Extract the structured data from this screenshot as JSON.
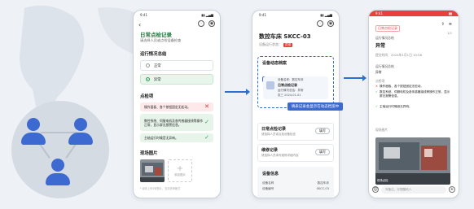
{
  "colors": {
    "accent_green": "#1f7a3e",
    "accent_blue": "#3d6ad0",
    "accent_red": "#e8413c"
  },
  "phone1": {
    "time": "9:41",
    "title": "日常点检记录",
    "subtitle": "请选择人员或点检设备检查",
    "run_section": "运行情况总结",
    "options": [
      "正常",
      "异常"
    ],
    "checks_section": "点检项",
    "checks": [
      {
        "text": "操作面板、各个按钮固定无松动。",
        "status": "bad"
      },
      {
        "text": "数控系统、伺服电机及各传感器接线等操作正常，显示屏无报警信息。",
        "status": "good"
      },
      {
        "text": "主轴运行时噪音无异响。",
        "status": "good"
      }
    ],
    "photos_section": "现场图片",
    "add_photo": "添加图片",
    "hint": "* 最多上传9张照片，支持多种格式"
  },
  "phone2": {
    "time": "9:41",
    "title": "数控车床 SKCC-03",
    "subtitle": "设备运行状态：",
    "status_tag": "异常",
    "dynamics_title": "设备动态档案",
    "chips": [
      "维修记录 1",
      "日常点检 1"
    ],
    "mini": {
      "line1": "设备名称：数控车床",
      "line2": "日常点检记录",
      "line3": "运行情况总结：异常",
      "line4": "张三 2024-01-01"
    },
    "callout": "填表记录会显示在动态档案中",
    "records": [
      {
        "title": "日常点检记录",
        "desc": "请选择人员或点检设备检查",
        "btn": "填写"
      },
      {
        "title": "维修记录",
        "desc": "请选择人员填写维修详细内容",
        "btn": "填写"
      }
    ],
    "device_info": "设备信息",
    "device_rows": [
      {
        "k": "设备名称",
        "v": "数控车床"
      },
      {
        "k": "设备编号",
        "v": "SKCC-03"
      }
    ]
  },
  "phone3": {
    "time": "9:41",
    "tag": "日常点检记录",
    "tag_right": "1/1",
    "summary_label": "运行情况总结",
    "summary_value": "异常",
    "submit_time": "提交时间：2024年1月1日 10:58",
    "checks_label": "运行情况总结",
    "result_label": "异常",
    "items_label": "点检项",
    "items": [
      {
        "icon": "✕",
        "text": "操作面板、各个按钮固定无松动。",
        "status": "bad"
      },
      {
        "icon": "✓",
        "text": "数控系统、伺服电机及各传感器接线等操作正常，显示屏无报警信息。",
        "status": "good"
      },
      {
        "icon": "✓",
        "text": "主轴运行时噪音无异响。",
        "status": "good"
      }
    ],
    "photos_label": "现场图片",
    "photo_caption": "现场点检",
    "input_placeholder": "写备注、@提醒他人"
  }
}
